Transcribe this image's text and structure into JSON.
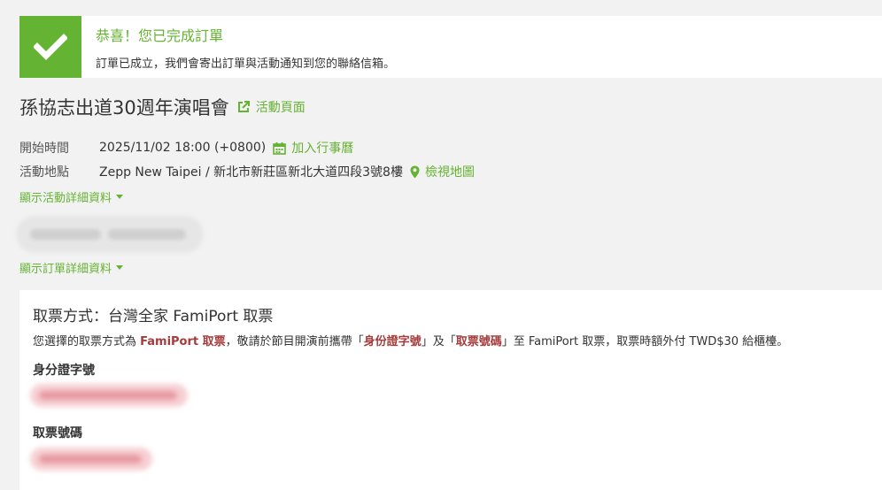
{
  "banner": {
    "title": "恭喜！您已完成訂單",
    "message": "訂單已成立，我們會寄出訂單與活動通知到您的聯絡信箱。"
  },
  "event": {
    "title": "孫協志出道30週年演唱會",
    "page_link": "活動頁面"
  },
  "details": {
    "start_label": "開始時間",
    "start_value": "2025/11/02 18:00 (+0800)",
    "calendar_link": "加入行事曆",
    "venue_label": "活動地點",
    "venue_value": "Zepp New Taipei / 新北市新莊區新北大道四段3號8樓",
    "map_link": "檢視地圖"
  },
  "toggles": {
    "event_details": "顯示活動詳細資料",
    "order_details": "顯示訂單詳細資料"
  },
  "pickup": {
    "title": "取票方式：台灣全家 FamiPort 取票",
    "desc_1": "您選擇的取票方式為 ",
    "desc_hl_1": "FamiPort 取票",
    "desc_2": "，敬請於節目開演前攜帶「",
    "desc_hl_2": "身份證字號",
    "desc_3": "」及「",
    "desc_hl_3": "取票號碼",
    "desc_4": "」至 FamiPort 取票，取票時額外付 TWD$30 給櫃檯。",
    "id_label": "身分證字號",
    "code_label": "取票號碼"
  },
  "colors": {
    "accent": "#65b332",
    "highlight": "#a53b3b"
  }
}
